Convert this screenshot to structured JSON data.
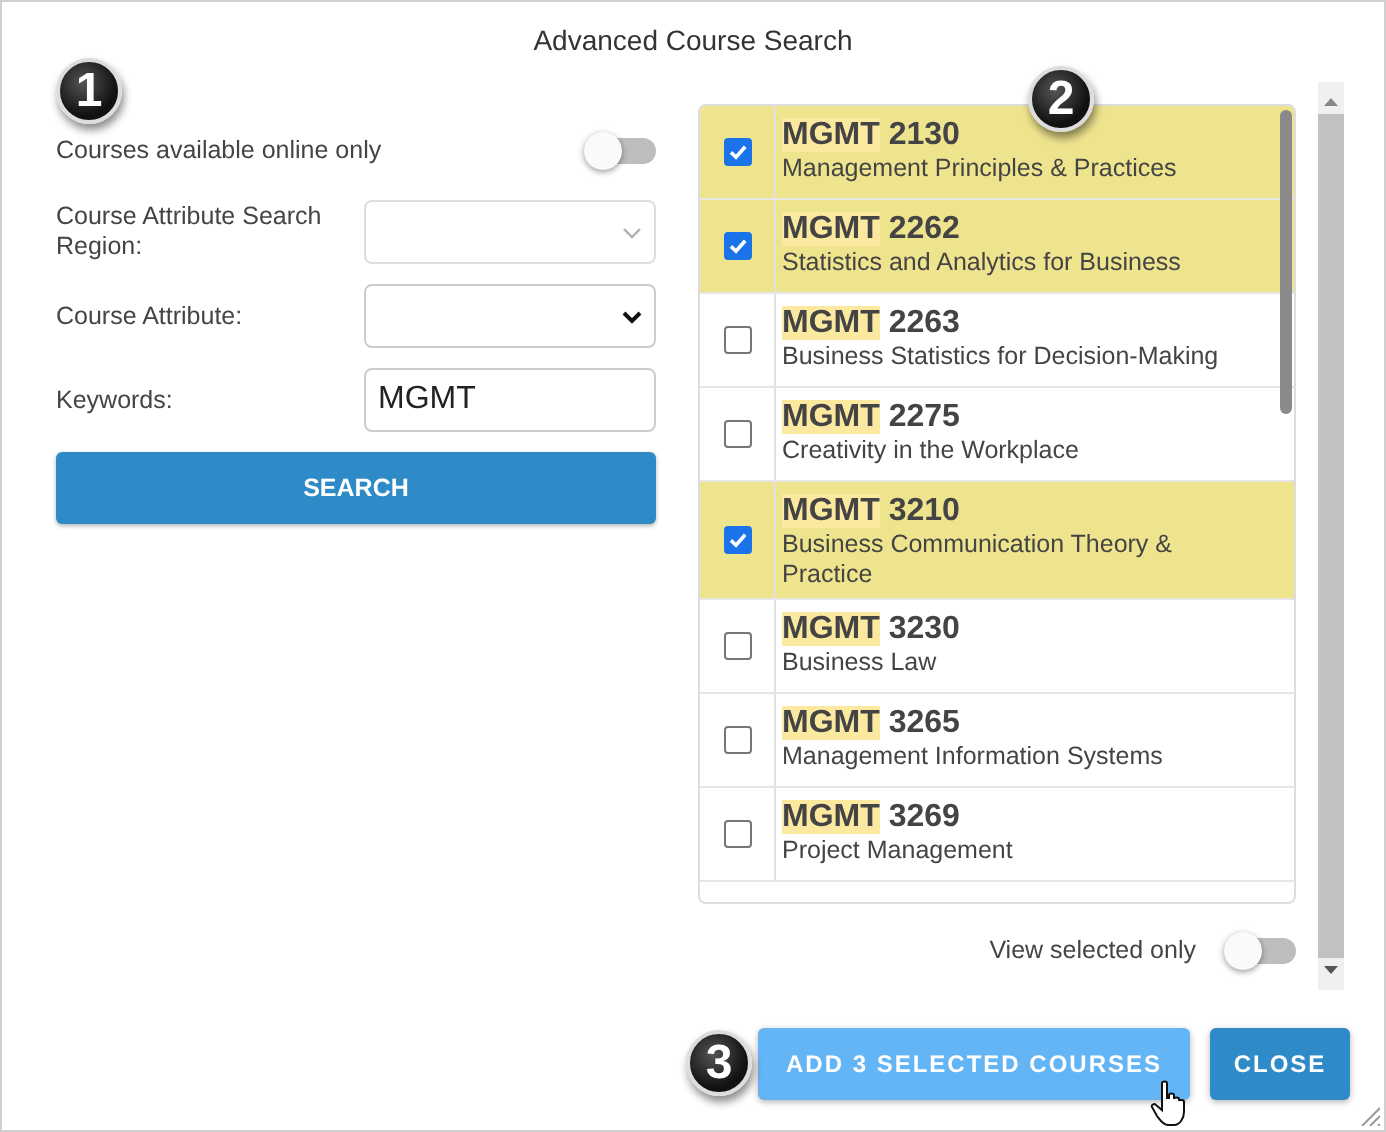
{
  "dialog": {
    "title": "Advanced Course Search"
  },
  "step_badges": [
    "1",
    "2",
    "3"
  ],
  "filters": {
    "online_only": {
      "label": "Courses available online only",
      "on": false
    },
    "fields": [
      {
        "kind": "select",
        "label": "Course Attribute Search Region:",
        "disabled": true
      },
      {
        "kind": "select",
        "label": "Course Attribute:",
        "disabled": false
      },
      {
        "kind": "text",
        "label": "Keywords:",
        "value": "MGMT"
      }
    ],
    "search_button": "SEARCH"
  },
  "courses": [
    {
      "match": "MGMT",
      "number": "2130",
      "title": "Management Principles & Practices",
      "checked": true
    },
    {
      "match": "MGMT",
      "number": "2262",
      "title": "Statistics and Analytics for Business",
      "checked": true
    },
    {
      "match": "MGMT",
      "number": "2263",
      "title": "Business Statistics for Decision-Making",
      "checked": false
    },
    {
      "match": "MGMT",
      "number": "2275",
      "title": "Creativity in the Workplace",
      "checked": false
    },
    {
      "match": "MGMT",
      "number": "3210",
      "title": "Business Communication Theory & Practice",
      "checked": true
    },
    {
      "match": "MGMT",
      "number": "3230",
      "title": "Business Law",
      "checked": false
    },
    {
      "match": "MGMT",
      "number": "3265",
      "title": "Management Information Systems",
      "checked": false
    },
    {
      "match": "MGMT",
      "number": "3269",
      "title": "Project Management",
      "checked": false
    }
  ],
  "view_selected_only": {
    "label": "View selected only",
    "on": false
  },
  "buttons": {
    "add": "ADD 3 SELECTED COURSES",
    "close": "CLOSE"
  }
}
